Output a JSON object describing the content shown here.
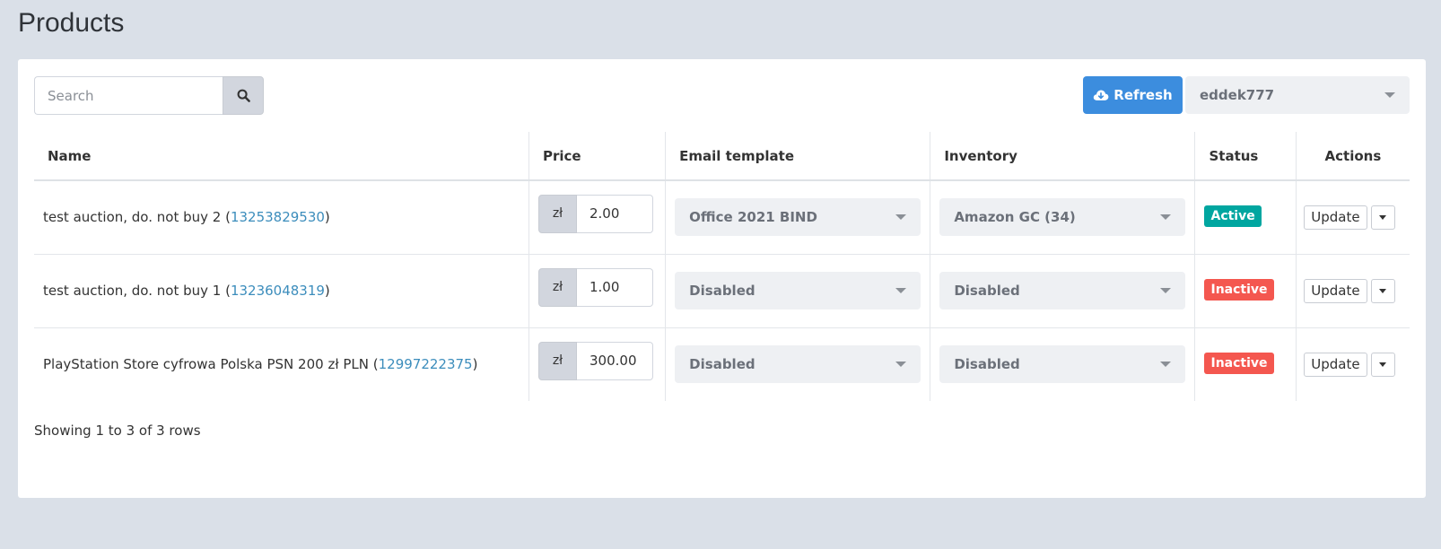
{
  "page": {
    "title": "Products"
  },
  "toolbar": {
    "search_placeholder": "Search",
    "search_icon": "search-icon",
    "refresh_label": "Refresh",
    "refresh_icon": "cloud-download-icon",
    "account": "eddek777"
  },
  "table": {
    "columns": [
      "Name",
      "Price",
      "Email template",
      "Inventory",
      "Status",
      "Actions"
    ],
    "rows": [
      {
        "name": "test auction, do. not buy 2",
        "item_id": "13253829530",
        "currency": "zł",
        "price": "2.00",
        "email_template": "Office 2021 BIND",
        "inventory": "Amazon GC (34)",
        "status": "Active",
        "status_color": "#00a6a0",
        "update_label": "Update"
      },
      {
        "name": "test auction, do. not buy 1",
        "item_id": "13236048319",
        "currency": "zł",
        "price": "1.00",
        "email_template": "Disabled",
        "inventory": "Disabled",
        "status": "Inactive",
        "status_color": "#f4574f",
        "update_label": "Update"
      },
      {
        "name": "PlayStation Store cyfrowa Polska PSN 200 zł PLN",
        "item_id": "12997222375",
        "currency": "zł",
        "price": "300.00",
        "email_template": "Disabled",
        "inventory": "Disabled",
        "status": "Inactive",
        "status_color": "#f4574f",
        "update_label": "Update"
      }
    ]
  },
  "footer": {
    "info": "Showing 1 to 3 of 3 rows"
  },
  "colors": {
    "accent": "#3c8dde",
    "link": "#3c8dbc",
    "background": "#dae0e8"
  }
}
